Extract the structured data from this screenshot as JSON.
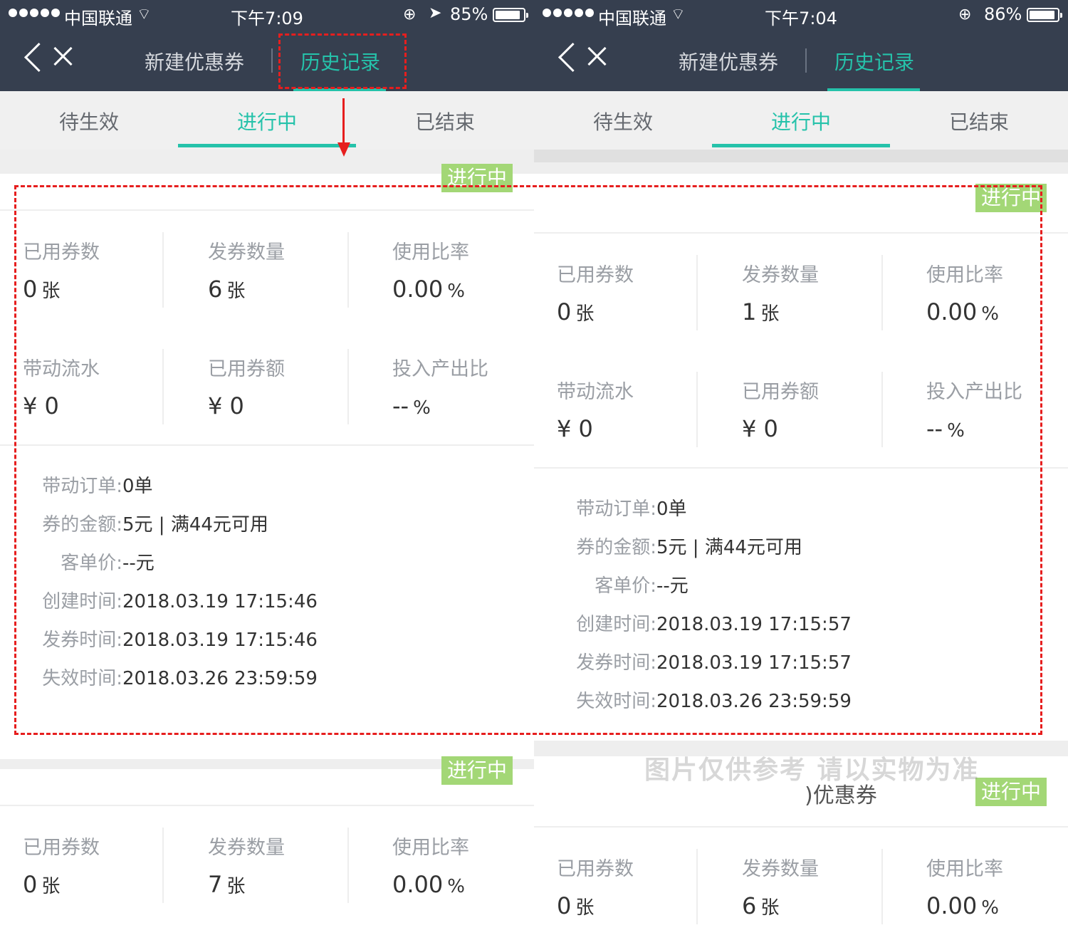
{
  "panels": [
    {
      "status": {
        "carrier": "中国联通",
        "time": "下午7:09",
        "battery": "85%",
        "battery_level": 0.85
      },
      "nav": {
        "tab_new": "新建优惠券",
        "tab_history": "历史记录"
      },
      "subtabs": [
        "待生效",
        "进行中",
        "已结束"
      ],
      "cards": [
        {
          "badge": "进行中",
          "stats": [
            {
              "label": "已用券数",
              "value": "0",
              "unit": "张"
            },
            {
              "label": "发券数量",
              "value": "6",
              "unit": "张"
            },
            {
              "label": "使用比率",
              "value": "0.00",
              "unit": "%"
            },
            {
              "label": "带动流水",
              "value": "¥ 0",
              "unit": ""
            },
            {
              "label": "已用券额",
              "value": "¥ 0",
              "unit": ""
            },
            {
              "label": "投入产出比",
              "value": "--",
              "unit": "%"
            }
          ],
          "info": [
            {
              "k": "带动订单:",
              "v": "0单"
            },
            {
              "k": "券的金额:",
              "v": "5元 | 满44元可用"
            },
            {
              "k": "客单价:",
              "v": "--元"
            },
            {
              "k": "创建时间:",
              "v": "2018.03.19 17:15:46"
            },
            {
              "k": "发券时间:",
              "v": "2018.03.19 17:15:46"
            },
            {
              "k": "失效时间:",
              "v": "2018.03.26 23:59:59"
            }
          ]
        },
        {
          "badge": "进行中",
          "stats": [
            {
              "label": "已用券数",
              "value": "0",
              "unit": "张"
            },
            {
              "label": "发券数量",
              "value": "7",
              "unit": "张"
            },
            {
              "label": "使用比率",
              "value": "0.00",
              "unit": "%"
            }
          ]
        }
      ]
    },
    {
      "status": {
        "carrier": "中国联通",
        "time": "下午7:04",
        "battery": "86%",
        "battery_level": 0.86
      },
      "nav": {
        "tab_new": "新建优惠券",
        "tab_history": "历史记录"
      },
      "subtabs": [
        "待生效",
        "进行中",
        "已结束"
      ],
      "cards": [
        {
          "badge": "进行中",
          "stats": [
            {
              "label": "已用券数",
              "value": "0",
              "unit": "张"
            },
            {
              "label": "发券数量",
              "value": "1",
              "unit": "张"
            },
            {
              "label": "使用比率",
              "value": "0.00",
              "unit": "%"
            },
            {
              "label": "带动流水",
              "value": "¥ 0",
              "unit": ""
            },
            {
              "label": "已用券额",
              "value": "¥ 0",
              "unit": ""
            },
            {
              "label": "投入产出比",
              "value": "--",
              "unit": "%"
            }
          ],
          "info": [
            {
              "k": "带动订单:",
              "v": "0单"
            },
            {
              "k": "券的金额:",
              "v": "5元 | 满44元可用"
            },
            {
              "k": "客单价:",
              "v": "--元"
            },
            {
              "k": "创建时间:",
              "v": "2018.03.19 17:15:57"
            },
            {
              "k": "发券时间:",
              "v": "2018.03.19 17:15:57"
            },
            {
              "k": "失效时间:",
              "v": "2018.03.26 23:59:59"
            }
          ]
        },
        {
          "badge": "进行中",
          "title": ")优惠券",
          "stats": [
            {
              "label": "已用券数",
              "value": "0",
              "unit": "张"
            },
            {
              "label": "发券数量",
              "value": "6",
              "unit": "张"
            },
            {
              "label": "使用比率",
              "value": "0.00",
              "unit": "%"
            }
          ]
        }
      ]
    }
  ],
  "watermark": "图片仅供参考 请以实物为准",
  "colors": {
    "header": "#363f4f",
    "accent": "#25c2aa",
    "badge": "#a3d776",
    "annotation": "#e61e1e"
  }
}
